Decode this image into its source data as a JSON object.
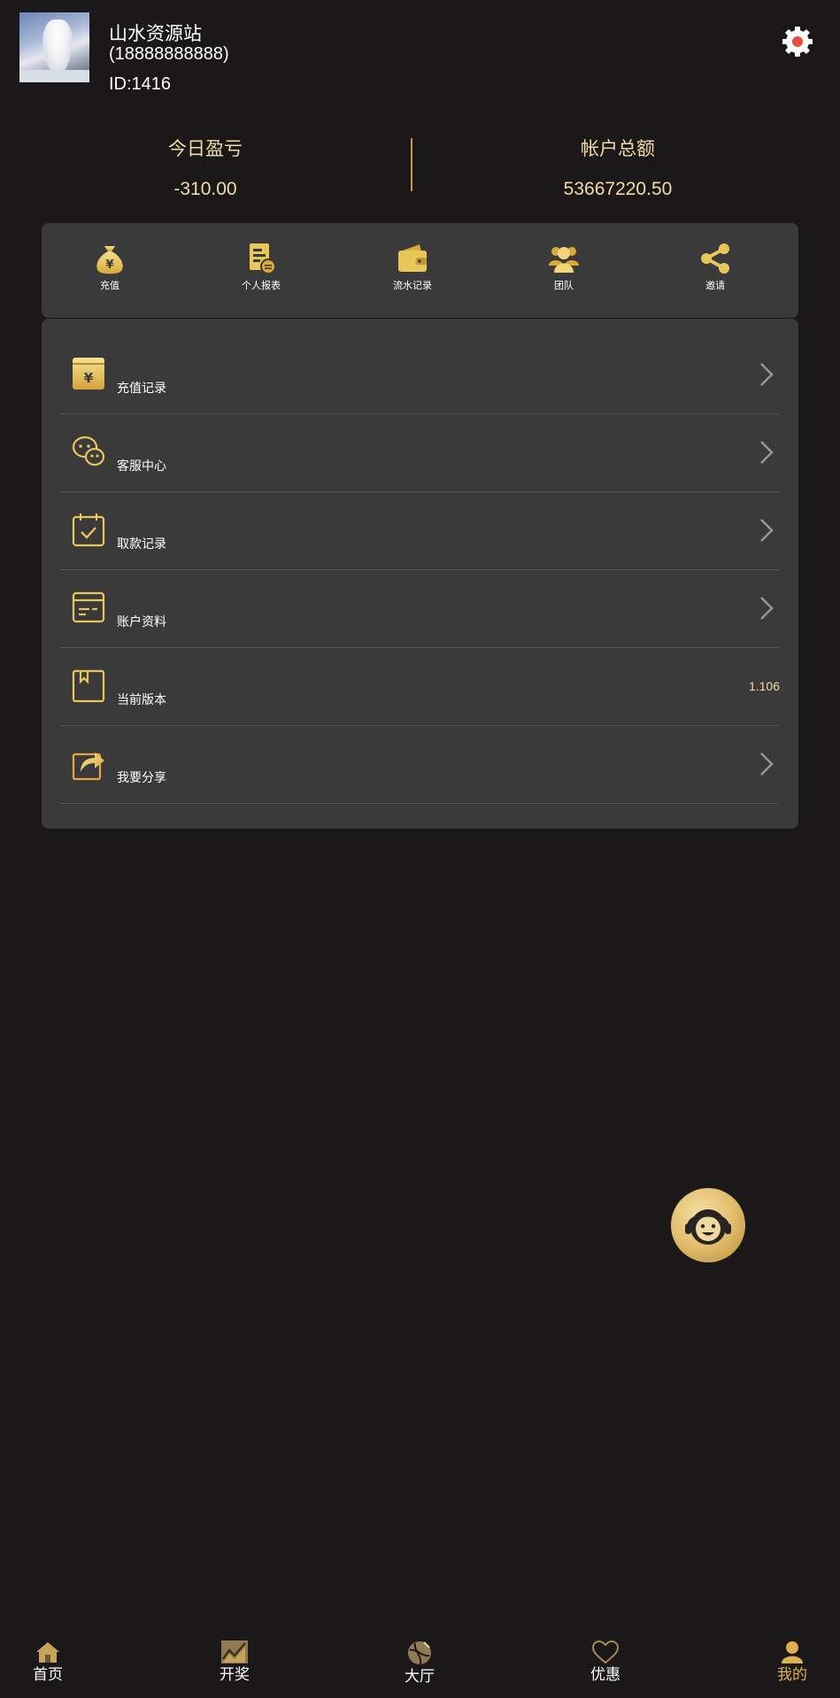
{
  "header": {
    "user_name": "山水资源站",
    "phone": "(18888888888)",
    "user_id": "ID:1416",
    "settings_icon": "gear-icon"
  },
  "stats": {
    "today_profit_label": "今日盈亏",
    "today_profit_value": "-310.00",
    "balance_label": "帐户总额",
    "balance_value": "53667220.50"
  },
  "quick_actions": [
    {
      "label": "充值",
      "icon": "money-bag-icon"
    },
    {
      "label": "个人报表",
      "icon": "report-icon"
    },
    {
      "label": "流水记录",
      "icon": "wallet-icon"
    },
    {
      "label": "团队",
      "icon": "team-icon"
    },
    {
      "label": "邀请",
      "icon": "share-icon"
    }
  ],
  "menu": [
    {
      "label": "充值记录",
      "icon": "recharge-record-icon"
    },
    {
      "label": "客服中心",
      "icon": "chat-icon"
    },
    {
      "label": "取款记录",
      "icon": "calendar-check-icon"
    },
    {
      "label": "账户资料",
      "icon": "card-icon"
    },
    {
      "label": "当前版本",
      "icon": "bookmark-icon",
      "value": "1.106"
    },
    {
      "label": "我要分享",
      "icon": "share-arrow-icon"
    }
  ],
  "bottom_nav": [
    {
      "label": "首页",
      "icon": "home-icon"
    },
    {
      "label": "开奖",
      "icon": "chart-icon"
    },
    {
      "label": "大厅",
      "icon": "ball-icon"
    },
    {
      "label": "优惠",
      "icon": "heart-icon"
    },
    {
      "label": "我的",
      "icon": "user-icon",
      "active": true
    }
  ],
  "colors": {
    "background": "#1a1819",
    "card": "#3b3a3b",
    "gold": "#e0b04f",
    "gold_text": "#f1dca3"
  }
}
